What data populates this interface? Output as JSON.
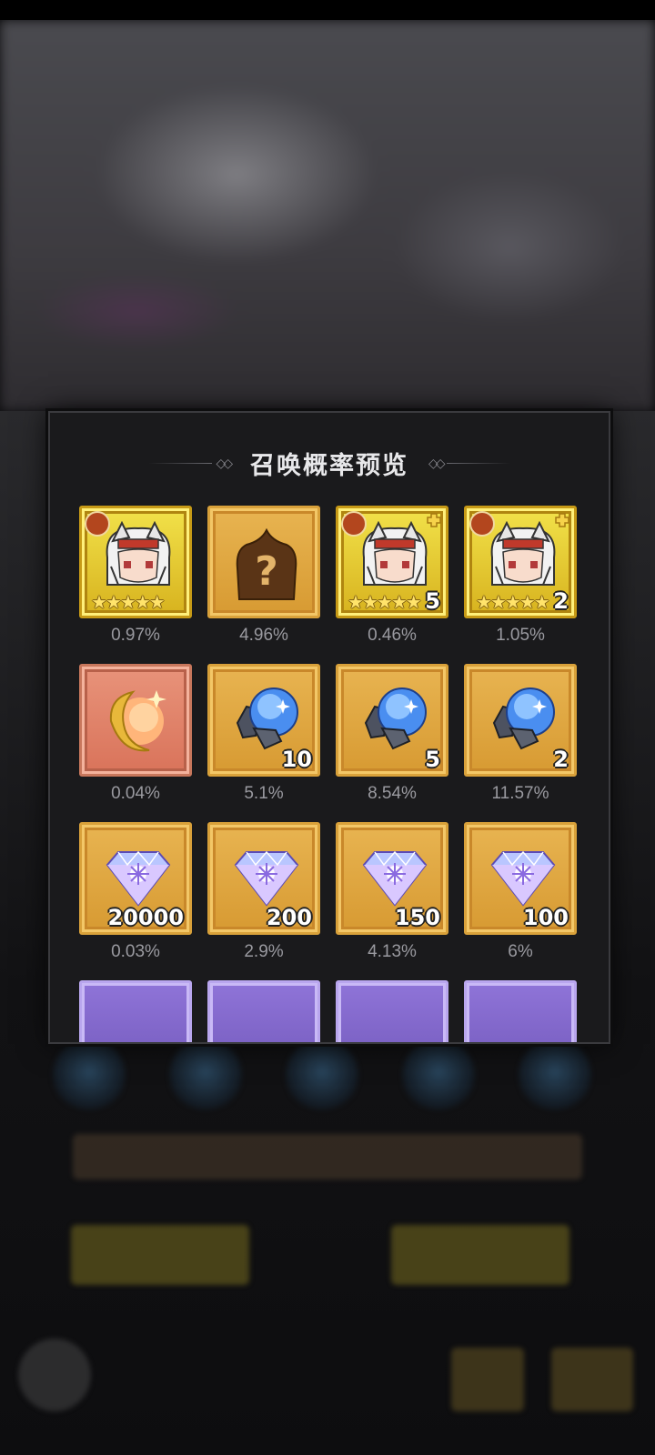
{
  "dialog": {
    "title": "召唤概率预览"
  },
  "rows": [
    [
      {
        "kind": "character",
        "frame": "gold",
        "stars": 5,
        "qty": "",
        "pct": "0.97%",
        "icon": "character-portrait"
      },
      {
        "kind": "mystery",
        "frame": "orange",
        "qty": "",
        "pct": "4.96%",
        "icon": "question-mark-icon"
      },
      {
        "kind": "character",
        "frame": "gold",
        "stars": 5,
        "qty": "5",
        "pct": "0.46%",
        "icon": "character-portrait"
      },
      {
        "kind": "character",
        "frame": "gold",
        "stars": 5,
        "qty": "2",
        "pct": "1.05%",
        "icon": "character-portrait"
      }
    ],
    [
      {
        "kind": "orb",
        "frame": "red",
        "qty": "",
        "pct": "0.04%",
        "icon": "golden-orb-icon"
      },
      {
        "kind": "stone",
        "frame": "orange",
        "qty": "10",
        "pct": "5.1%",
        "icon": "blue-stone-icon"
      },
      {
        "kind": "stone",
        "frame": "orange",
        "qty": "5",
        "pct": "8.54%",
        "icon": "blue-stone-icon"
      },
      {
        "kind": "stone",
        "frame": "orange",
        "qty": "2",
        "pct": "11.57%",
        "icon": "blue-stone-icon"
      }
    ],
    [
      {
        "kind": "diamond",
        "frame": "orange",
        "qty": "20000",
        "pct": "0.03%",
        "icon": "diamond-icon"
      },
      {
        "kind": "diamond",
        "frame": "orange",
        "qty": "200",
        "pct": "2.9%",
        "icon": "diamond-icon"
      },
      {
        "kind": "diamond",
        "frame": "orange",
        "qty": "150",
        "pct": "4.13%",
        "icon": "diamond-icon"
      },
      {
        "kind": "diamond",
        "frame": "orange",
        "qty": "100",
        "pct": "6%",
        "icon": "diamond-icon"
      }
    ],
    [
      {
        "kind": "partial",
        "frame": "purple",
        "qty": "",
        "pct": "",
        "icon": "item-icon"
      },
      {
        "kind": "partial",
        "frame": "purple",
        "qty": "",
        "pct": "",
        "icon": "item-icon"
      },
      {
        "kind": "partial",
        "frame": "purple",
        "qty": "",
        "pct": "",
        "icon": "item-icon"
      },
      {
        "kind": "partial",
        "frame": "purple",
        "qty": "",
        "pct": "",
        "icon": "item-icon"
      }
    ]
  ],
  "colors": {
    "frame_orange": "#d99a32",
    "frame_gold": "#e6c62a",
    "frame_red": "#d9735a",
    "frame_purple": "#7b62c8",
    "panel": "#1a1a1c",
    "percent_text": "#9a9aa0"
  }
}
